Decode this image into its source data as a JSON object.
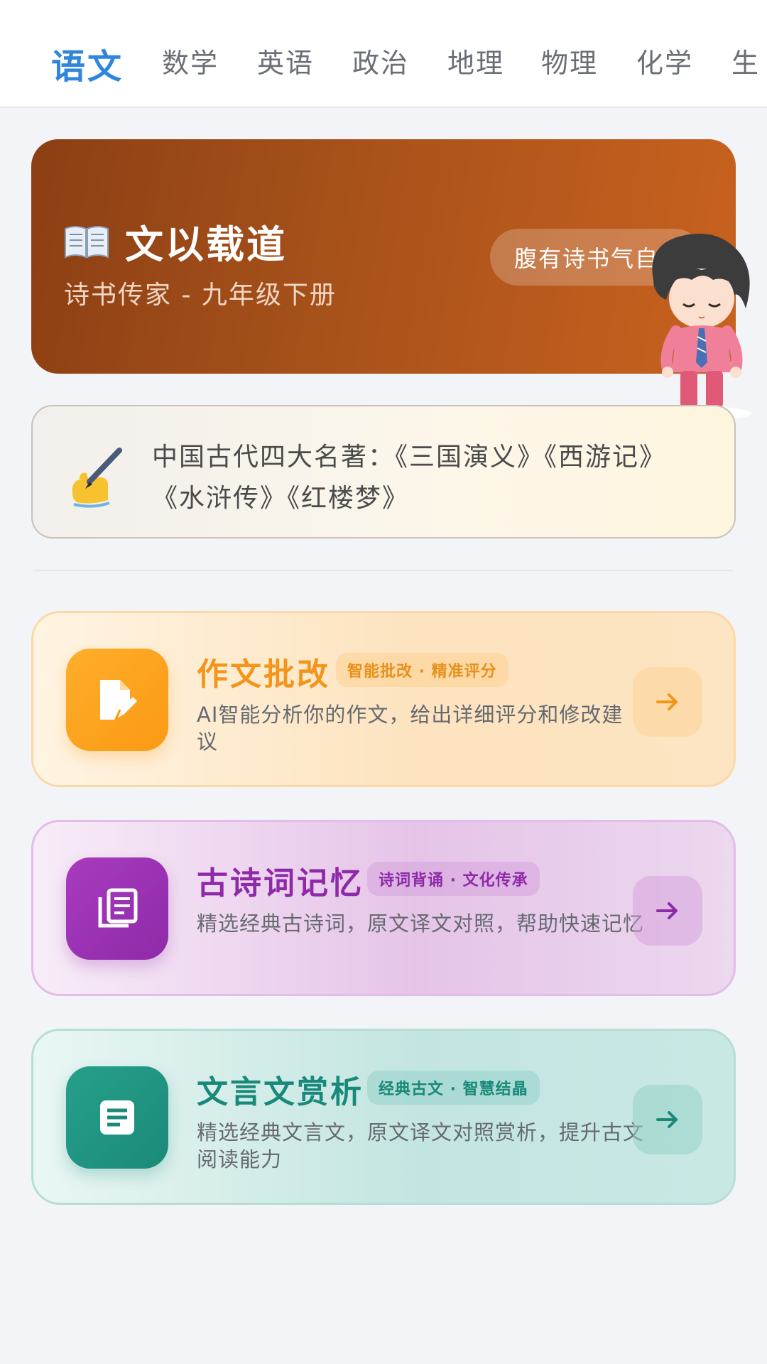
{
  "tabs": [
    {
      "label": "语文",
      "active": true
    },
    {
      "label": "数学"
    },
    {
      "label": "英语"
    },
    {
      "label": "政治"
    },
    {
      "label": "地理"
    },
    {
      "label": "物理"
    },
    {
      "label": "化学"
    },
    {
      "label": "生"
    }
  ],
  "hero": {
    "title": "文以载道",
    "subtitle": "诗书传家 - 九年级下册",
    "pill": "腹有诗书气自"
  },
  "quote": {
    "line1": "中国古代四大名著：《三国演义》《西游记》",
    "line2": "《水浒传》《红楼梦》"
  },
  "features": {
    "essay": {
      "title": "作文批改",
      "tag": "智能批改 · 精准评分",
      "desc": "AI智能分析你的作文，给出详细评分和修改建议",
      "icon": "document-edit-icon",
      "color": "#f2951a"
    },
    "poem": {
      "title": "古诗词记忆",
      "tag": "诗词背诵 · 文化传承",
      "desc": "精选经典古诗词，原文译文对照，帮助快速记忆",
      "icon": "notes-stack-icon",
      "color": "#8e2aa8"
    },
    "classic": {
      "title": "文言文赏析",
      "tag": "经典古文 · 智慧结晶",
      "desc": "精选经典文言文，原文译文对照赏析，提升古文阅读能力",
      "icon": "article-icon",
      "color": "#19897a"
    }
  }
}
